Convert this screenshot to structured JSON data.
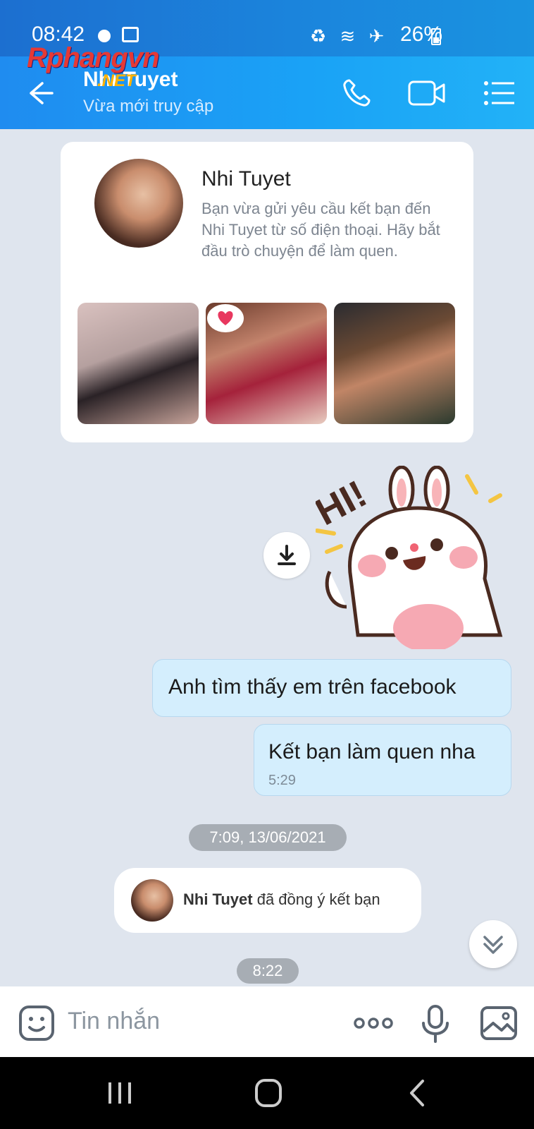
{
  "status_bar": {
    "time": "08:42",
    "battery": "26%",
    "accent_color": "#1c6fd0"
  },
  "watermark": {
    "text": "Rphangvn",
    "sub": ".NET"
  },
  "header": {
    "title": "Nhi Tuyet",
    "subtitle": "Vừa mới truy cập",
    "icons": [
      "back-arrow-icon",
      "phone-icon",
      "video-call-icon",
      "menu-list-icon"
    ]
  },
  "profile_card": {
    "name": "Nhi Tuyet",
    "description": "Bạn vừa gửi yêu cầu kết bạn đến Nhi Tuyet từ số điện thoại. Hãy bắt đầu trò chuyện để làm quen."
  },
  "sticker": {
    "text": "HI!"
  },
  "messages": [
    {
      "text": "Anh tìm thấy em trên facebook"
    },
    {
      "text": "Kết bạn làm quen nha",
      "time": "5:29"
    }
  ],
  "date_chip": "7:09, 13/06/2021",
  "notification": {
    "name": "Nhi Tuyet",
    "action": " đã đồng ý kết bạn"
  },
  "time_chip": "8:22",
  "input": {
    "placeholder": "Tin nhắn"
  },
  "colors": {
    "header": "#1aa3f6",
    "bubble": "#d4eefd",
    "background": "#dfe5ee"
  }
}
